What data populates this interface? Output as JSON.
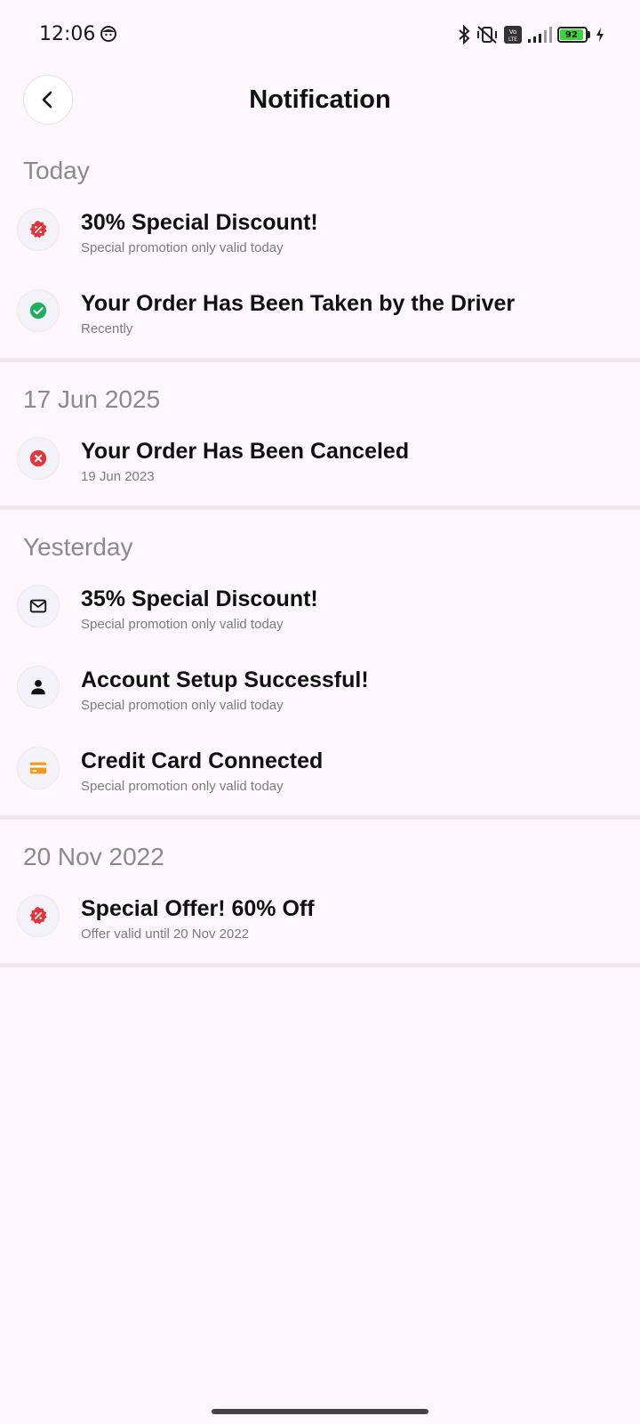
{
  "status_bar": {
    "time": "12:06",
    "battery_level": "92",
    "icons": [
      "face-icon",
      "bluetooth-icon",
      "vibrate-off-icon",
      "volte-icon",
      "signal-icon",
      "battery-icon",
      "charging-icon"
    ]
  },
  "header": {
    "title": "Notification",
    "back_icon": "chevron-left-icon"
  },
  "sections": [
    {
      "heading": "Today",
      "items": [
        {
          "title": "30% Special Discount!",
          "subtitle": "Special promotion only valid today",
          "icon": "discount-icon",
          "icon_color": "#e0353d"
        },
        {
          "title": "Your Order Has Been Taken by the Driver",
          "subtitle": "Recently",
          "icon": "check-circle-icon",
          "icon_color": "#1fae5b"
        }
      ]
    },
    {
      "heading": "17 Jun 2025",
      "items": [
        {
          "title": "Your Order Has Been Canceled",
          "subtitle": "19 Jun 2023",
          "icon": "cancel-circle-icon",
          "icon_color": "#e0353d"
        }
      ]
    },
    {
      "heading": "Yesterday",
      "items": [
        {
          "title": "35% Special Discount!",
          "subtitle": "Special promotion only valid today",
          "icon": "mail-icon",
          "icon_color": "#111111"
        },
        {
          "title": "Account Setup Successful!",
          "subtitle": "Special promotion only valid today",
          "icon": "person-icon",
          "icon_color": "#111111"
        },
        {
          "title": "Credit Card Connected",
          "subtitle": "Special promotion only valid today",
          "icon": "credit-card-icon",
          "icon_color": "#f39a1e"
        }
      ]
    },
    {
      "heading": "20 Nov 2022",
      "items": [
        {
          "title": "Special Offer! 60% Off",
          "subtitle": "Offer valid until 20 Nov 2022",
          "icon": "discount-icon",
          "icon_color": "#e0353d"
        }
      ]
    }
  ]
}
